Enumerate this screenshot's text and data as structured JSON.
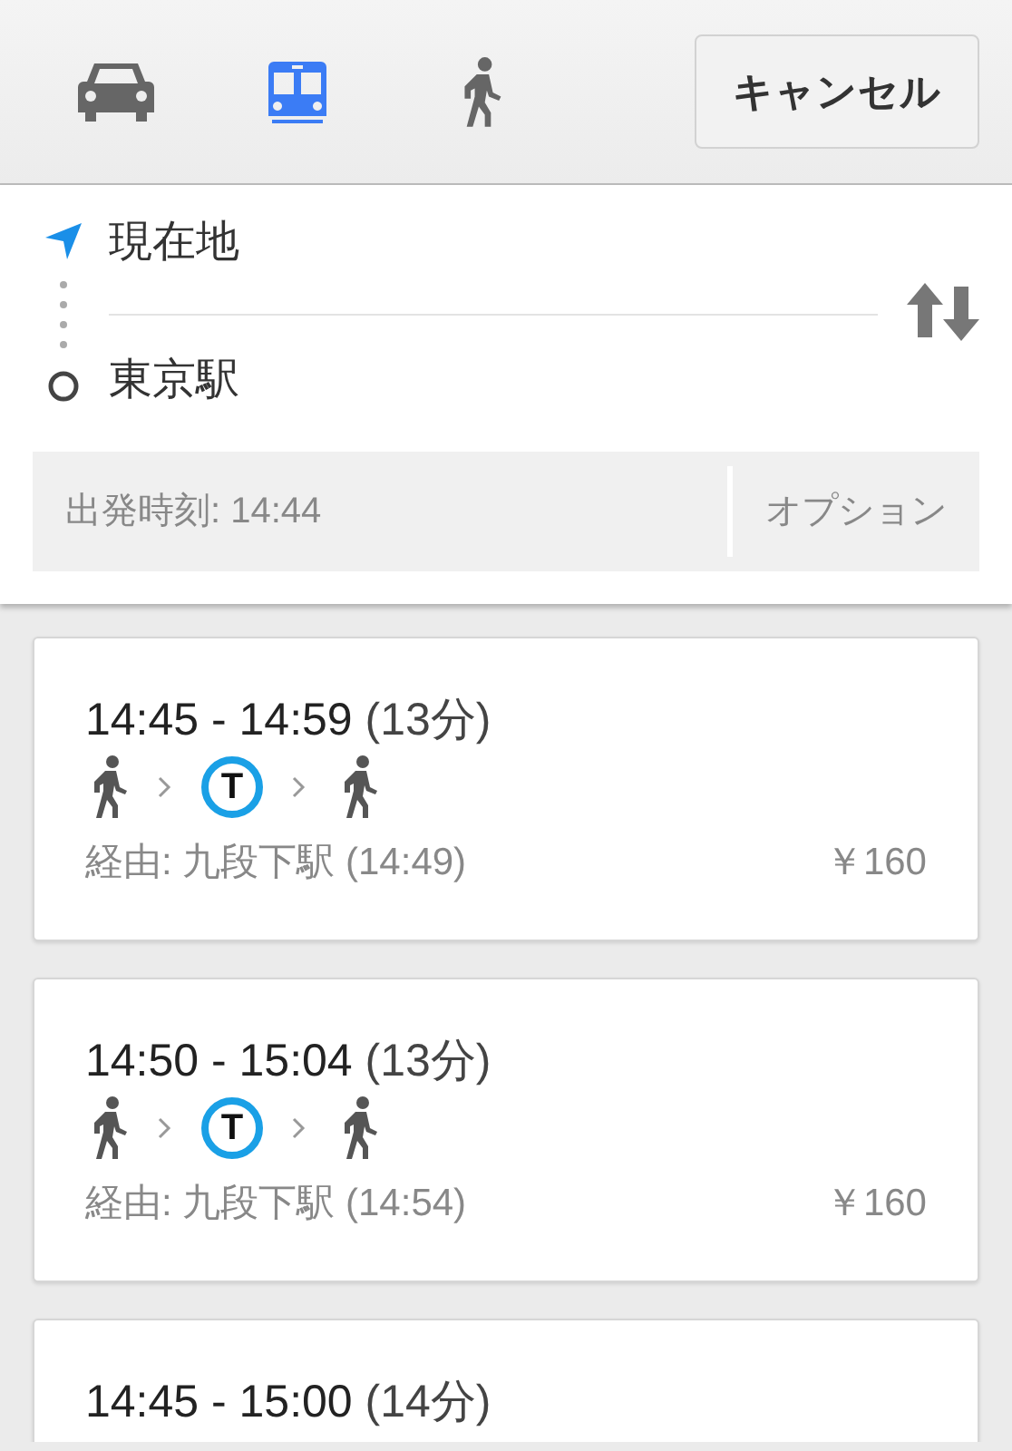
{
  "modes": [
    {
      "kind": "car",
      "selected": false
    },
    {
      "kind": "transit",
      "selected": true
    },
    {
      "kind": "walk",
      "selected": false
    }
  ],
  "cancel_button": "キャンセル",
  "route": {
    "origin": "現在地",
    "destination": "東京駅"
  },
  "departure": "出発時刻: 14:44",
  "options_button": "オプション",
  "results": [
    {
      "time": "14:45 - 14:59",
      "duration": "(13分)",
      "steps": [
        {
          "kind": "walk"
        },
        {
          "kind": "metro",
          "label": "T"
        },
        {
          "kind": "walk"
        }
      ],
      "via": "経由: 九段下駅 (14:49)",
      "fare": "￥160"
    },
    {
      "time": "14:50 - 15:04",
      "duration": "(13分)",
      "steps": [
        {
          "kind": "walk"
        },
        {
          "kind": "metro",
          "label": "T"
        },
        {
          "kind": "walk"
        }
      ],
      "via": "経由: 九段下駅 (14:54)",
      "fare": "￥160"
    },
    {
      "time": "14:45 - 15:00",
      "duration": "(14分)"
    }
  ]
}
